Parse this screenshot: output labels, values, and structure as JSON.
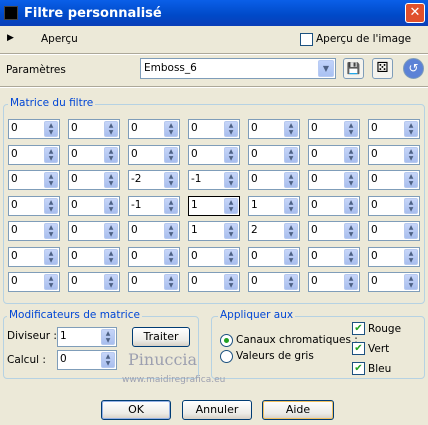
{
  "window": {
    "title": "Filtre personnalisé",
    "close_glyph": "✕"
  },
  "preview": {
    "label": "Aperçu",
    "expander_glyph": "▶",
    "image_preview_label": "Aperçu de l'image",
    "image_preview_checked": false
  },
  "params": {
    "label": "Paramètres",
    "preset": "Emboss_6",
    "dropdown_glyph": "▼",
    "save_glyph": "💾",
    "random_glyph": "⚄",
    "reset_glyph": "↺"
  },
  "matrix": {
    "label": "Matrice du filtre",
    "values": [
      [
        "0",
        "0",
        "0",
        "0",
        "0",
        "0",
        "0"
      ],
      [
        "0",
        "0",
        "0",
        "0",
        "0",
        "0",
        "0"
      ],
      [
        "0",
        "0",
        "-2",
        "-1",
        "0",
        "0",
        "0"
      ],
      [
        "0",
        "0",
        "-1",
        "1",
        "1",
        "0",
        "0"
      ],
      [
        "0",
        "0",
        "0",
        "1",
        "2",
        "0",
        "0"
      ],
      [
        "0",
        "0",
        "0",
        "0",
        "0",
        "0",
        "0"
      ],
      [
        "0",
        "0",
        "0",
        "0",
        "0",
        "0",
        "0"
      ]
    ],
    "spinner_glyph": "▲▼"
  },
  "modifiers": {
    "label": "Modificateurs de matrice",
    "divisor_label": "Diviseur :",
    "divisor_value": "1",
    "bias_label": "Calcul :",
    "bias_value": "0",
    "process_label": "Traiter"
  },
  "apply": {
    "label": "Appliquer aux",
    "chromatic_label": "Canaux chromatiques :",
    "gray_label": "Valeurs de gris",
    "selected": "chromatic",
    "red_label": "Rouge",
    "green_label": "Vert",
    "blue_label": "Bleu",
    "red_checked": true,
    "green_checked": true,
    "blue_checked": true,
    "check_glyph": "✔"
  },
  "watermark": {
    "name": "Pinuccia",
    "url": "www.maidiregrafica.eu"
  },
  "buttons": {
    "ok": "OK",
    "cancel": "Annuler",
    "help": "Aide"
  }
}
